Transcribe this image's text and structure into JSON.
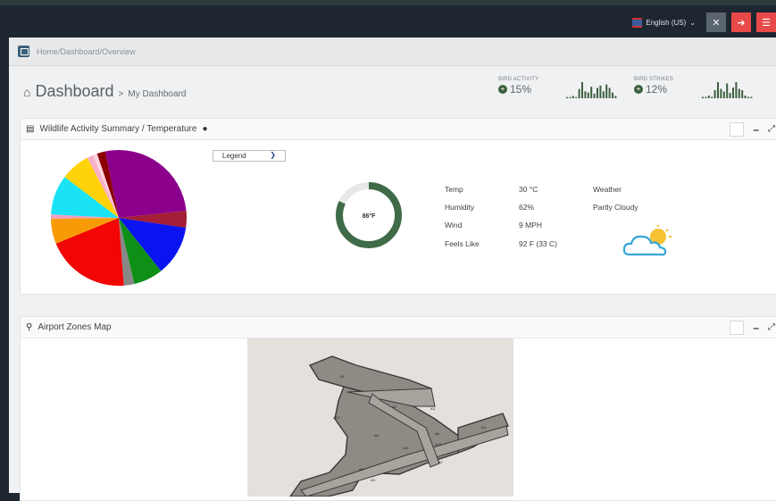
{
  "topbar": {
    "language": "English (US)",
    "buttons": [
      {
        "icon": "expand-icon",
        "color": "#5a6470"
      },
      {
        "icon": "logout-icon",
        "color": "#e84a4a"
      },
      {
        "icon": "menu-icon",
        "color": "#e84a4a"
      }
    ]
  },
  "breadcrumb": {
    "items": [
      "Home",
      "Dashboard",
      "Overview"
    ]
  },
  "header": {
    "title": "Dashboard",
    "separator": ">",
    "subtitle": "My Dashboard"
  },
  "stats": [
    {
      "label": "BIRD ACTIVITY",
      "value": "15%",
      "icon": "plus-circle-icon"
    },
    {
      "label": "BIRD STRIKES",
      "value": "12%",
      "icon": "plus-circle-icon"
    }
  ],
  "wildlife_panel": {
    "title": "Wildlife Activity Summary / Temperature",
    "legend_select": "Legend",
    "gauge": {
      "value_label": "86°F",
      "fraction": 0.82,
      "color": "#3f6b48"
    },
    "weather": {
      "rows": [
        {
          "label": "Temp",
          "value": "30 °C"
        },
        {
          "label": "Humidity",
          "value": "62%"
        },
        {
          "label": "Wind",
          "value": "9 MPH"
        },
        {
          "label": "Feels Like",
          "value": "92 F (33 C)"
        }
      ],
      "condition_label": "Weather",
      "condition": "Partly Cloudy"
    },
    "pie_colors": [
      "#8b008b",
      "#a31e36",
      "#0a14f0",
      "#0e8f16",
      "#888888",
      "#f10505",
      "#f89a06",
      "#f0a0c0",
      "#19e3f5",
      "#ffd20a",
      "#f7b0c8",
      "#ffd3e0",
      "#8b0000"
    ],
    "pie_fractions": [
      0.265,
      0.04,
      0.12,
      0.07,
      0.025,
      0.2,
      0.06,
      0.01,
      0.095,
      0.07,
      0.015,
      0.01,
      0.02
    ]
  },
  "map_panel": {
    "title": "Airport Zones Map",
    "zone_labels": [
      "A1",
      "A2",
      "A3",
      "A4",
      "A5",
      "A6",
      "A7",
      "A8",
      "A9",
      "A10",
      "A11",
      "A12"
    ]
  },
  "colors": {
    "sidebar": "#1e2631",
    "accent_green": "#3c5f3f",
    "danger": "#e84a4a"
  }
}
